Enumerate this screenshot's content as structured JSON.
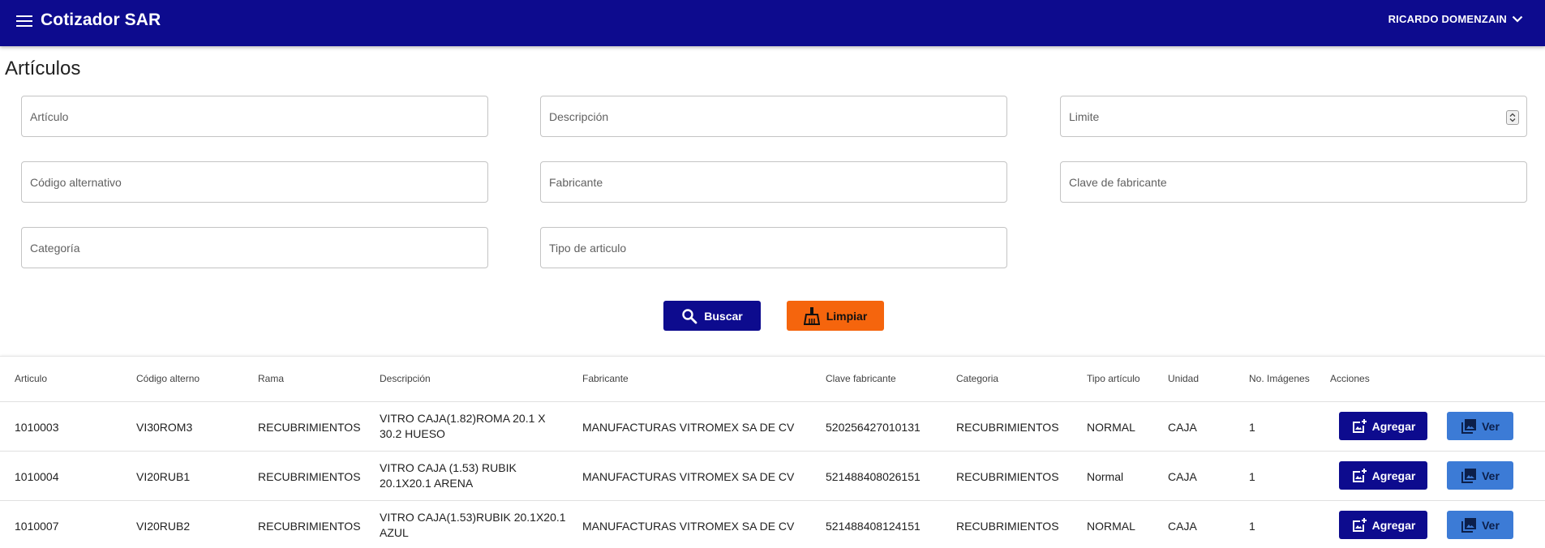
{
  "header": {
    "title": "Cotizador SAR",
    "user": "RICARDO DOMENZAIN"
  },
  "page": {
    "title": "Artículos"
  },
  "filters": {
    "articulo": "Artículo",
    "descripcion": "Descripción",
    "limite": "Limite",
    "codigo_alternativo": "Código alternativo",
    "fabricante": "Fabricante",
    "clave_fabricante": "Clave de fabricante",
    "categoria": "Categoría",
    "tipo_articulo": "Tipo de articulo"
  },
  "buttons": {
    "buscar": "Buscar",
    "limpiar": "Limpiar"
  },
  "table": {
    "columns": [
      "Articulo",
      "Código alterno",
      "Rama",
      "Descripción",
      "Fabricante",
      "Clave fabricante",
      "Categoria",
      "Tipo artículo",
      "Unidad",
      "No. Imágenes",
      "Acciones"
    ],
    "rows": [
      {
        "articulo": "1010003",
        "codigo": "VI30ROM3",
        "rama": "RECUBRIMIENTOS",
        "descripcion": "VITRO CAJA(1.82)ROMA 20.1 X 30.2 HUESO",
        "fabricante": "MANUFACTURAS VITROMEX SA DE CV",
        "clave": "520256427010131",
        "categoria": "RECUBRIMIENTOS",
        "tipo": "NORMAL",
        "unidad": "CAJA",
        "imagenes": "1"
      },
      {
        "articulo": "1010004",
        "codigo": "VI20RUB1",
        "rama": "RECUBRIMIENTOS",
        "descripcion": "VITRO CAJA (1.53) RUBIK 20.1X20.1 ARENA",
        "fabricante": "MANUFACTURAS VITROMEX SA DE CV",
        "clave": "521488408026151",
        "categoria": "RECUBRIMIENTOS",
        "tipo": "Normal",
        "unidad": "CAJA",
        "imagenes": "1"
      },
      {
        "articulo": "1010007",
        "codigo": "VI20RUB2",
        "rama": "RECUBRIMIENTOS",
        "descripcion": "VITRO CAJA(1.53)RUBIK 20.1X20.1 AZUL",
        "fabricante": "MANUFACTURAS VITROMEX SA DE CV",
        "clave": "521488408124151",
        "categoria": "RECUBRIMIENTOS",
        "tipo": "NORMAL",
        "unidad": "CAJA",
        "imagenes": "1"
      }
    ],
    "actions": {
      "agregar": "Agregar",
      "ver": "Ver"
    }
  },
  "icons": {
    "menu": "menu-icon",
    "chevron": "chevron-down-icon",
    "search": "search-icon",
    "clean": "broom-icon",
    "add_photo": "add-photo-icon",
    "gallery": "photo-library-icon"
  },
  "colors": {
    "primary": "#0d0b8e",
    "accent": "#f5650d",
    "view": "#3c7bd6"
  }
}
